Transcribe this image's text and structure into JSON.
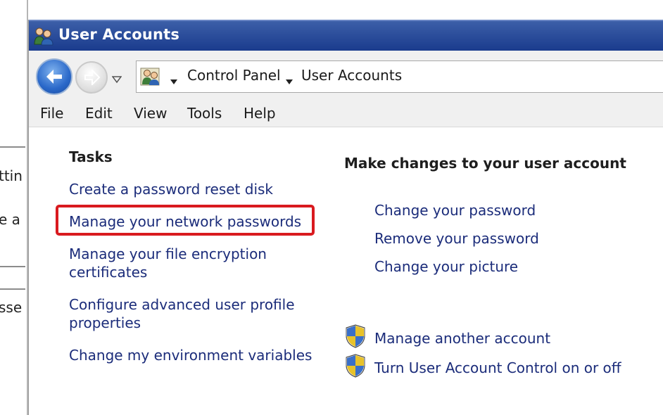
{
  "background_window": {
    "fragments": [
      "ttin",
      "e a",
      "sse"
    ]
  },
  "window": {
    "title": "User Accounts",
    "icon": "user-accounts-icon"
  },
  "navigation": {
    "back_icon": "back-arrow-icon",
    "forward_icon": "forward-arrow-icon",
    "breadcrumb": [
      "Control Panel",
      "User Accounts"
    ]
  },
  "menu": {
    "items": [
      "File",
      "Edit",
      "View",
      "Tools",
      "Help"
    ]
  },
  "tasks": {
    "heading": "Tasks",
    "links": [
      "Create a password reset disk",
      "Manage your network passwords",
      "Manage your file encryption\ncertificates",
      "Configure advanced user profile\nproperties",
      "Change my environment variables"
    ],
    "highlighted_index": 1
  },
  "main": {
    "heading": "Make changes to your user account",
    "links": [
      "Change your password",
      "Remove your password",
      "Change your picture"
    ],
    "admin_links": [
      "Manage another account",
      "Turn User Account Control on or off"
    ]
  },
  "colors": {
    "titlebar": "#1a3b8d",
    "link": "#1b2c7a",
    "highlight_box": "#d91a1f"
  }
}
